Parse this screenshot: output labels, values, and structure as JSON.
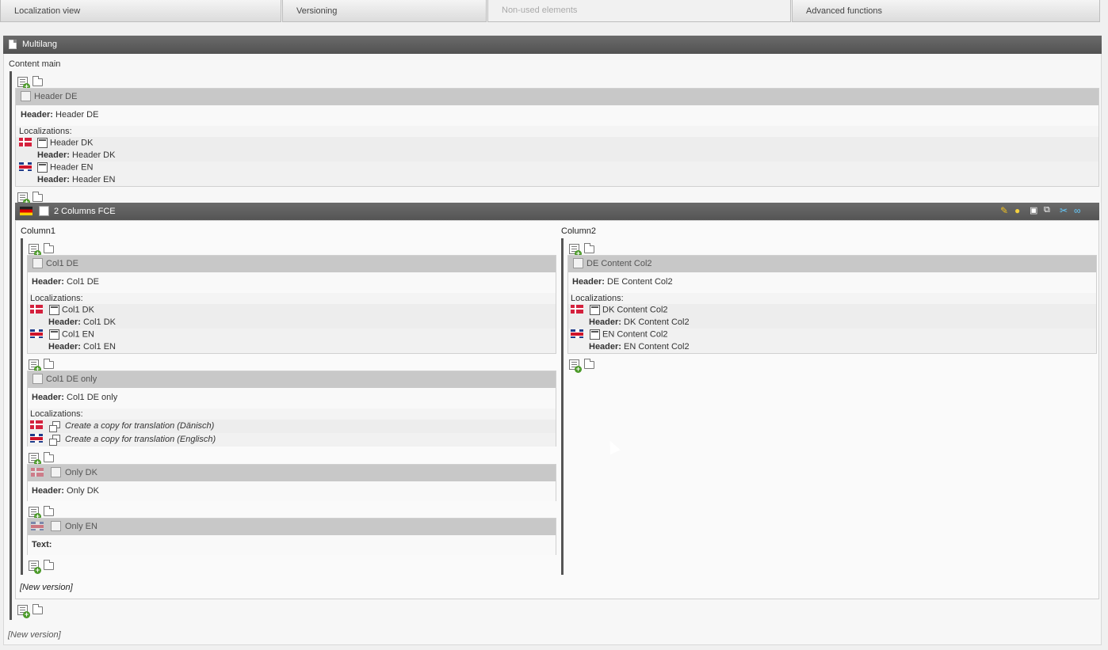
{
  "tabs": [
    {
      "label": "Localization view",
      "enabled": true
    },
    {
      "label": "Versioning",
      "enabled": true
    },
    {
      "label": "Non-used elements",
      "enabled": false
    },
    {
      "label": "Advanced functions",
      "enabled": true
    }
  ],
  "page": {
    "title": "Multilang",
    "area_label": "Content main"
  },
  "header_de": {
    "title": "Header DE",
    "field_label": "Header:",
    "field_value": "Header DE",
    "localizations_label": "Localizations:",
    "loc_dk_title": "Header DK",
    "loc_dk_value": "Header DK",
    "loc_en_title": "Header EN",
    "loc_en_value": "Header EN"
  },
  "fce": {
    "title": "2 Columns FCE",
    "column1_label": "Column1",
    "column2_label": "Column2",
    "new_version": "[New version]"
  },
  "col1_de": {
    "title": "Col1 DE",
    "field_label": "Header:",
    "field_value": "Col1 DE",
    "localizations_label": "Localizations:",
    "loc_dk_title": "Col1 DK",
    "loc_dk_value": "Col1 DK",
    "loc_en_title": "Col1 EN",
    "loc_en_value": "Col1 EN"
  },
  "col1_de_only": {
    "title": "Col1 DE only",
    "field_label": "Header:",
    "field_value": "Col1 DE only",
    "localizations_label": "Localizations:",
    "copy_dk": "Create a copy for translation (Dänisch)",
    "copy_en": "Create a copy for translation (Englisch)"
  },
  "only_dk": {
    "title": "Only DK",
    "field_label": "Header:",
    "field_value": "Only DK"
  },
  "only_en": {
    "title": "Only EN",
    "field_label": "Text:"
  },
  "col2_de": {
    "title": "DE Content Col2",
    "field_label": "Header:",
    "field_value": "DE Content Col2",
    "localizations_label": "Localizations:",
    "loc_dk_title": "DK Content Col2",
    "loc_dk_value": "DK Content Col2",
    "loc_en_title": "EN Content Col2",
    "loc_en_value": "EN Content Col2"
  },
  "footer": {
    "new_version": "[New version]"
  },
  "colors": {
    "accent_bar": "#5e5e5e",
    "box_header": "#c8c8c8",
    "add_green": "#4c9a2a"
  },
  "icons": [
    "doc-icon",
    "new-content-icon",
    "folder-icon",
    "flag-dk-icon",
    "flag-gb-icon",
    "flag-de-icon",
    "copy-icon",
    "edit-icon",
    "info-icon",
    "move-icon",
    "localize-icon",
    "cut-icon",
    "link-icon"
  ]
}
